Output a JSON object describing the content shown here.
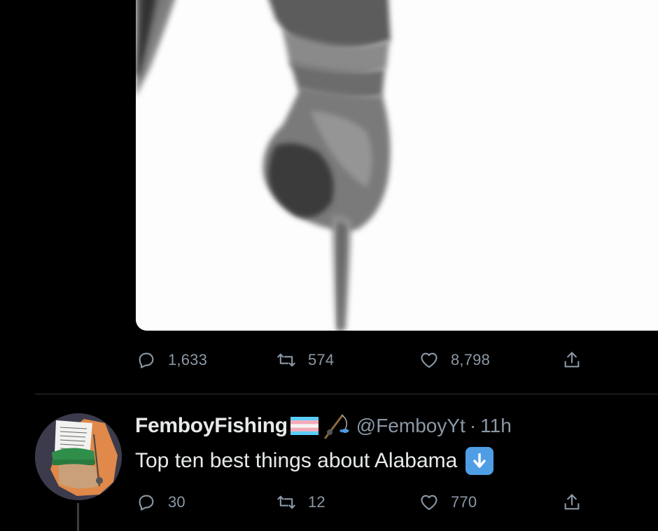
{
  "top_tweet": {
    "media_alt": "",
    "replies": "1,633",
    "retweets": "574",
    "likes": "8,798"
  },
  "reply_tweet": {
    "display_name": "FemboyFishing",
    "handle": "@FemboyYt",
    "separator": "·",
    "time": "11h",
    "text": "Top ten best things about Alabama",
    "emoji_icons": [
      "transgender-flag-icon",
      "fishing-rod-icon",
      "down-arrow-emoji-icon"
    ],
    "replies": "30",
    "retweets": "12",
    "likes": "770"
  },
  "icons": {
    "reply": "reply-icon",
    "retweet": "retweet-icon",
    "like": "like-icon",
    "share": "share-icon"
  },
  "colors": {
    "background": "#000000",
    "text_primary": "#e7e9ea",
    "text_secondary": "#8b98a5",
    "divider": "#2f3336",
    "emoji_blue": "#4f9ee5"
  }
}
